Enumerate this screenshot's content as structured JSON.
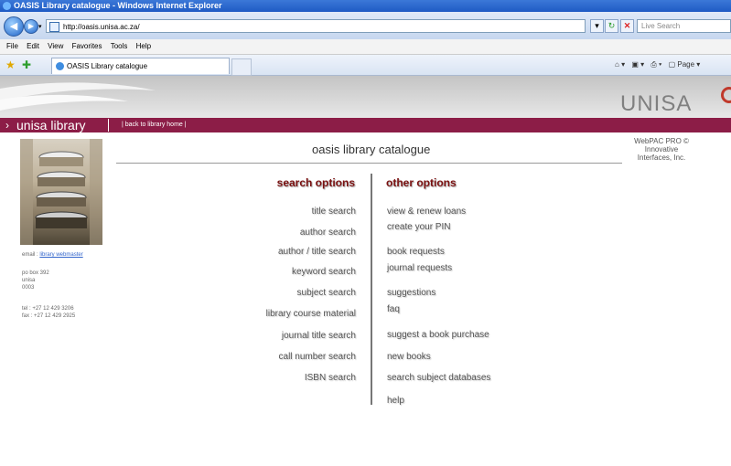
{
  "browser": {
    "window_title": "OASIS Library catalogue - Windows Internet Explorer",
    "address": "http://oasis.unisa.ac.za/",
    "live_search_placeholder": "Live Search",
    "menu": [
      "File",
      "Edit",
      "View",
      "Favorites",
      "Tools",
      "Help"
    ],
    "tab_label": "OASIS Library catalogue",
    "page_menu": "Page"
  },
  "header": {
    "brand": "UNISA",
    "library_name": "unisa library",
    "back_link": "| back to library home |"
  },
  "sidebar": {
    "email_label": "email :",
    "email_link": "library webmaster",
    "address": [
      "po box 392",
      "unisa",
      "0003"
    ],
    "tel": "tel : +27 12 429 3206",
    "fax": "fax : +27 12 429 2925"
  },
  "main": {
    "title": "oasis library catalogue",
    "webpac": [
      "WebPAC PRO ©",
      "Innovative",
      "Interfaces, Inc."
    ],
    "search_header": "search options",
    "other_header": "other options",
    "search_options": [
      "title search",
      "author search",
      "author / title search",
      "keyword search",
      "subject search",
      "library course material",
      "journal title search",
      "call number search",
      "ISBN search"
    ],
    "other_options": [
      "view & renew loans",
      "create your PIN",
      "book requests",
      "journal requests",
      "suggestions",
      "faq",
      "suggest a book purchase",
      "new books",
      "search subject databases",
      "help"
    ]
  }
}
